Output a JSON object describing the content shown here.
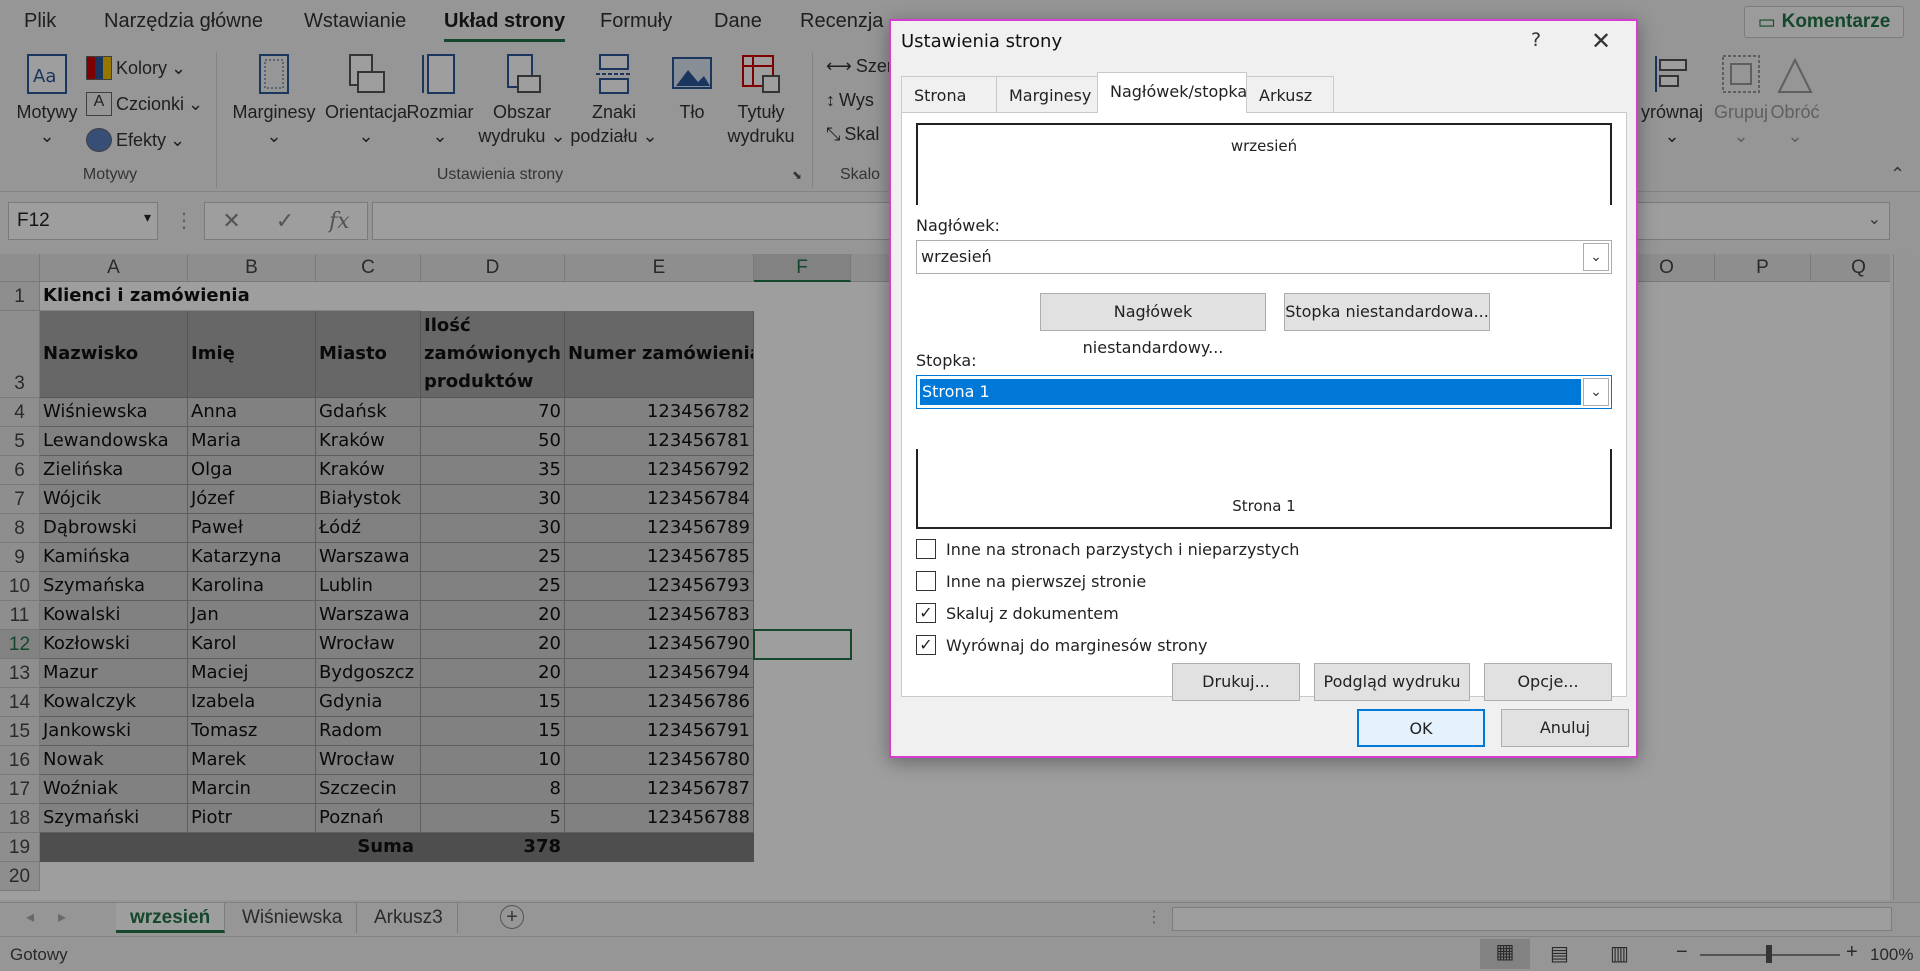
{
  "ribbon_tabs": [
    "Plik",
    "Narzędzia główne",
    "Wstawianie",
    "Układ strony",
    "Formuły",
    "Dane",
    "Recenzja"
  ],
  "active_tab": "Układ strony",
  "comment_button": "Komentarze",
  "ribbon": {
    "motywy": "Motywy",
    "kolory": "Kolory",
    "czcionki": "Czcionki",
    "efekty": "Efekty",
    "group_motywy": "Motywy",
    "marginesy": "Marginesy",
    "orientacja": "Orientacja",
    "rozmiar": "Rozmiar",
    "obszar1": "Obszar",
    "obszar2": "wydruku",
    "znaki1": "Znaki",
    "znaki2": "podziału",
    "tlo": "Tło",
    "tytuly1": "Tytuły",
    "tytuly2": "wydruku",
    "group_ustawienia": "Ustawienia strony",
    "szer": "Szer",
    "wys": "Wys",
    "skala": "Skal",
    "group_skal": "Skalo",
    "wyrownaj": "yrównaj",
    "grupuj": "Grupuj",
    "obroc": "Obróć"
  },
  "name_box": "F12",
  "columns": [
    "A",
    "B",
    "C",
    "D",
    "E",
    "F",
    "O",
    "P",
    "Q"
  ],
  "row_numbers": [
    "1",
    "3",
    "4",
    "5",
    "6",
    "7",
    "8",
    "9",
    "10",
    "11",
    "12",
    "13",
    "14",
    "15",
    "16",
    "17",
    "18",
    "19",
    "20"
  ],
  "table": {
    "title": "Klienci i zamówienia",
    "headers": [
      "Nazwisko",
      "Imię",
      "Miasto",
      "Ilość zamówionych produktów",
      "Numer zamówienia"
    ],
    "header_d_lines": [
      "Ilość",
      "zamówionych",
      "produktów"
    ],
    "rows": [
      [
        "Wiśniewska",
        "Anna",
        "Gdańsk",
        "70",
        "123456782"
      ],
      [
        "Lewandowska",
        "Maria",
        "Kraków",
        "50",
        "123456781"
      ],
      [
        "Zielińska",
        "Olga",
        "Kraków",
        "35",
        "123456792"
      ],
      [
        "Wójcik",
        "Józef",
        "Białystok",
        "30",
        "123456784"
      ],
      [
        "Dąbrowski",
        "Paweł",
        "Łódź",
        "30",
        "123456789"
      ],
      [
        "Kamińska",
        "Katarzyna",
        "Warszawa",
        "25",
        "123456785"
      ],
      [
        "Szymańska",
        "Karolina",
        "Lublin",
        "25",
        "123456793"
      ],
      [
        "Kowalski",
        "Jan",
        "Warszawa",
        "20",
        "123456783"
      ],
      [
        "Kozłowski",
        "Karol",
        "Wrocław",
        "20",
        "123456790"
      ],
      [
        "Mazur",
        "Maciej",
        "Bydgoszcz",
        "20",
        "123456794"
      ],
      [
        "Kowalczyk",
        "Izabela",
        "Gdynia",
        "15",
        "123456786"
      ],
      [
        "Jankowski",
        "Tomasz",
        "Radom",
        "15",
        "123456791"
      ],
      [
        "Nowak",
        "Marek",
        "Wrocław",
        "10",
        "123456780"
      ],
      [
        "Woźniak",
        "Marcin",
        "Szczecin",
        "8",
        "123456787"
      ],
      [
        "Szymański",
        "Piotr",
        "Poznań",
        "5",
        "123456788"
      ]
    ],
    "sum_label": "Suma",
    "sum_value": "378"
  },
  "sheet_tabs": [
    "wrzesień",
    "Wiśniewska",
    "Arkusz3"
  ],
  "active_sheet": "wrzesień",
  "status": "Gotowy",
  "zoom": "100%",
  "dialog": {
    "title": "Ustawienia strony",
    "help": "?",
    "tabs": [
      "Strona",
      "Marginesy",
      "Nagłówek/stopka",
      "Arkusz"
    ],
    "active_tab": "Nagłówek/stopka",
    "header_preview": "wrzesień",
    "header_label": "Nagłówek:",
    "header_value": "wrzesień",
    "custom_header_btn": "Nagłówek niestandardowy...",
    "custom_footer_btn": "Stopka niestandardowa...",
    "footer_label": "Stopka:",
    "footer_value": "Strona 1",
    "footer_preview": "Strona 1",
    "checkboxes": [
      {
        "label": "Inne na stronach parzystych i nieparzystych",
        "checked": false
      },
      {
        "label": "Inne na pierwszej stronie",
        "checked": false
      },
      {
        "label": "Skaluj z dokumentem",
        "checked": true
      },
      {
        "label": "Wyrównaj do marginesów strony",
        "checked": true
      }
    ],
    "print_btn": "Drukuj...",
    "preview_btn": "Podgląd wydruku",
    "options_btn": "Opcje...",
    "ok_btn": "OK",
    "cancel_btn": "Anuluj"
  },
  "colors": {
    "accent": "#217346",
    "dialog_border": "#d63cd0",
    "selection": "#0078d7"
  }
}
